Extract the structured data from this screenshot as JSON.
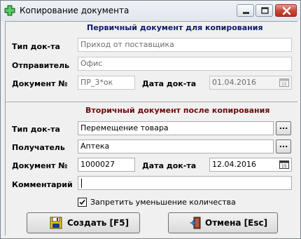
{
  "window": {
    "title": "Копирование документа"
  },
  "primary": {
    "heading": "Первичный документ для копирования",
    "doc_type_label": "Тип док-та",
    "doc_type_value": "Приход от поставщика",
    "sender_label": "Отправитель",
    "sender_value": "Офис",
    "doc_number_label": "Документ №",
    "doc_number_value": "ПР_3*ок",
    "doc_date_label": "Дата док-та",
    "doc_date_value": "01.04.2016"
  },
  "secondary": {
    "heading": "Вторичный документ после копирования",
    "doc_type_label": "Тип док-та",
    "doc_type_value": "Перемещение товара",
    "recipient_label": "Получатель",
    "recipient_value": "Аптека",
    "doc_number_label": "Документ №",
    "doc_number_value": "1000027",
    "doc_date_label": "Дата док-та",
    "doc_date_value": "12.04.2016",
    "comment_label": "Комментарий",
    "comment_value": "",
    "browse_label": "..."
  },
  "options": {
    "forbid_decrease_label": "Запретить уменьшение количества",
    "forbid_decrease_checked": true
  },
  "buttons": {
    "create_label": "Создать [F5]",
    "cancel_label": "Отмена [Esc]"
  },
  "icons": {
    "app": "green-plus-icon",
    "calendar": "calendar-icon",
    "create": "floppy-disk-icon",
    "cancel": "exit-door-icon"
  },
  "colors": {
    "primary_heading": "#0a1c66",
    "secondary_heading": "#6d0a0a"
  }
}
